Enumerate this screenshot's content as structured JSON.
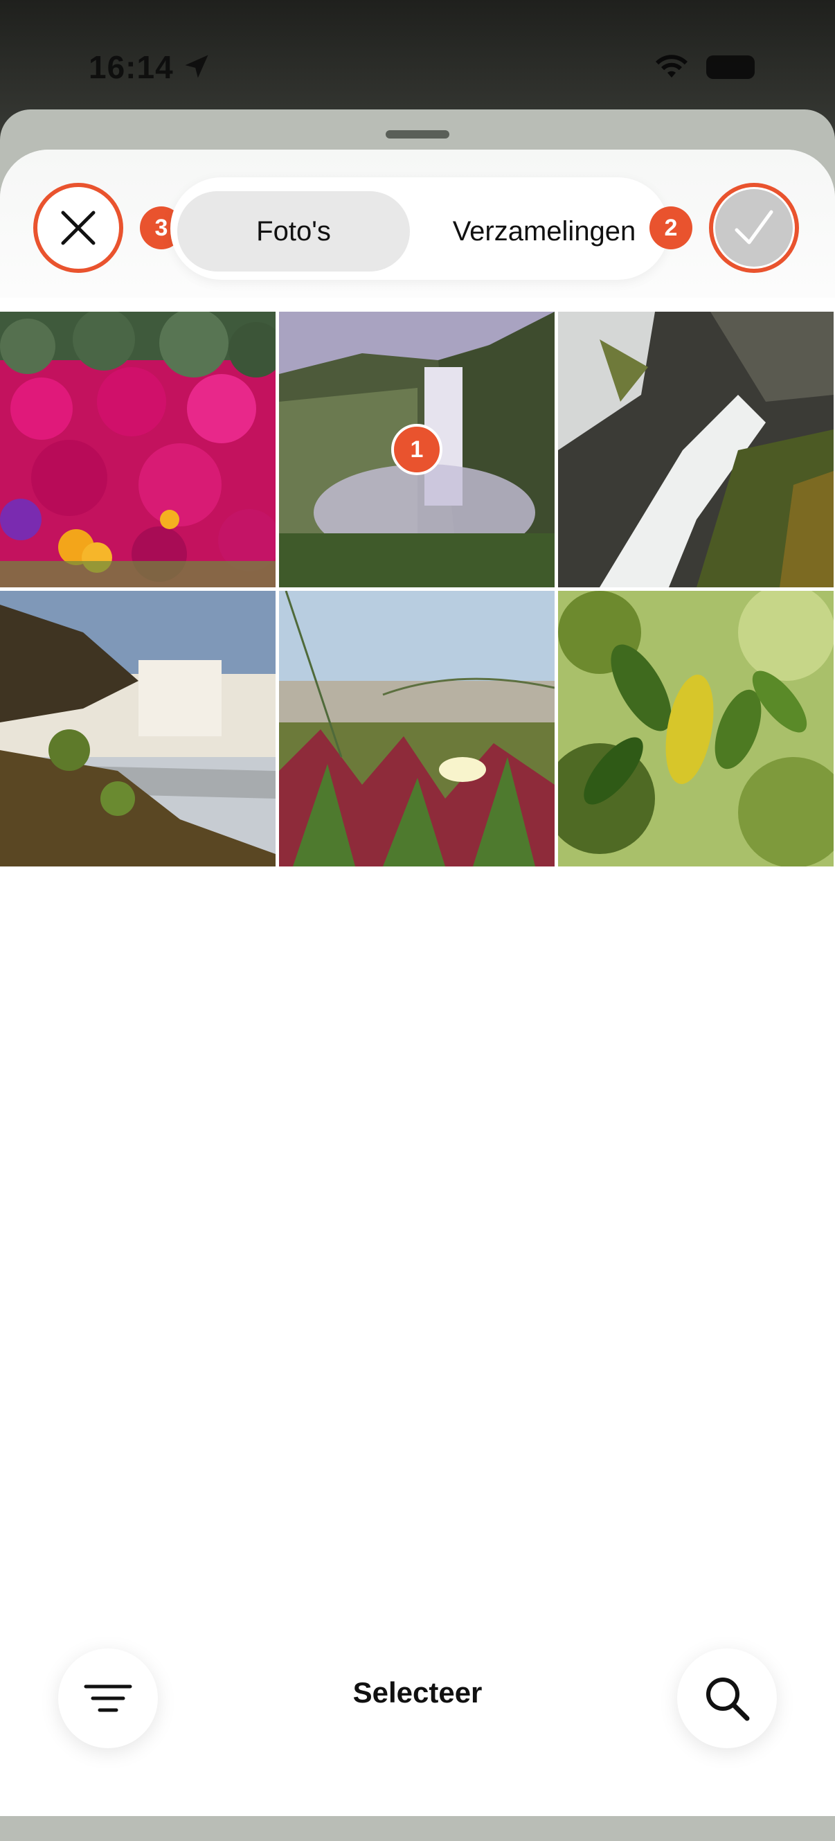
{
  "status_bar": {
    "time": "16:14",
    "icons": [
      "location-arrow-icon",
      "wifi-icon",
      "battery-icon"
    ]
  },
  "header": {
    "close_icon": "close-icon",
    "confirm_icon": "checkmark-icon",
    "tabs": [
      {
        "label": "Foto's",
        "selected": true
      },
      {
        "label": "Verzamelingen",
        "selected": false
      }
    ],
    "badges": {
      "close": "3",
      "confirm": "2",
      "photo": "1"
    }
  },
  "photos": [
    {
      "subject": "pink flowers"
    },
    {
      "subject": "waterfall valley"
    },
    {
      "subject": "waterfall rocks"
    },
    {
      "subject": "waterfall coast"
    },
    {
      "subject": "ice plant flower"
    },
    {
      "subject": "green leaves"
    }
  ],
  "bottom_bar": {
    "filter_icon": "filter-lines-icon",
    "select_label": "Selecteer",
    "search_icon": "search-icon"
  },
  "colors": {
    "accent": "#e9532e",
    "tab_active_bg": "#e8e8e8",
    "confirm_fill": "#c9c9c9",
    "sheet_bg": "#ffffff"
  }
}
